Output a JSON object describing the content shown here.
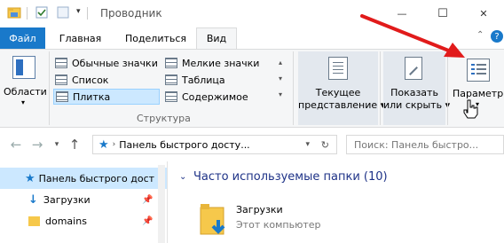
{
  "window": {
    "title": "Проводник",
    "minimize_label": "—",
    "maximize_label": "☐",
    "close_label": "✕"
  },
  "ribbon_tabs": {
    "file": "Файл",
    "home": "Главная",
    "share": "Поделиться",
    "view": "Вид"
  },
  "ribbon": {
    "pane_button": "Области",
    "layout_items": [
      "Обычные значки",
      "Мелкие значки",
      "Список",
      "Таблица",
      "Плитка",
      "Содержимое"
    ],
    "selected_layout": "Плитка",
    "group_label": "Структура",
    "current_view_button": [
      "Текущее",
      "представление"
    ],
    "show_hide_button": [
      "Показать",
      "или скрыть"
    ],
    "options_button": "Параметры"
  },
  "addressbar": {
    "path": "Панель быстрого досту...",
    "search_placeholder": "Поиск: Панель быстро..."
  },
  "navpane": {
    "items": [
      {
        "label": "Панель быстрого дост",
        "icon": "star-icon",
        "selected": true
      },
      {
        "label": "Загрузки",
        "icon": "download-icon",
        "pinned": true
      },
      {
        "label": "domains",
        "icon": "folder-icon",
        "pinned": true
      }
    ]
  },
  "content": {
    "section_title": "Часто используемые папки (10)",
    "folder": {
      "name": "Загрузки",
      "location": "Этот компьютер"
    }
  },
  "colors": {
    "accent": "#1979ca",
    "selected_bg": "#cce8ff",
    "annotation_arrow": "#e11b1b"
  }
}
